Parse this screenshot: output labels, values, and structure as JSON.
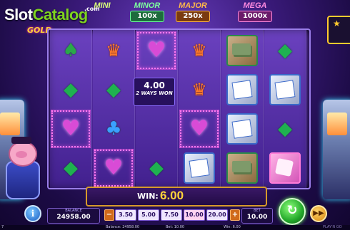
{
  "logo": {
    "brand_white": "Slot",
    "brand_green": "Catalog",
    "dotcom": ".com",
    "subtitle": "GOLD"
  },
  "jackpots": {
    "mini": {
      "name": "MINI"
    },
    "minor": {
      "name": "MINOR",
      "value": "100x"
    },
    "major": {
      "name": "MAJOR",
      "value": "250x"
    },
    "mega": {
      "name": "MEGA",
      "value": "1000x"
    }
  },
  "reels": [
    [
      "spade",
      "diamond",
      "heart",
      "diamond"
    ],
    [
      "crown",
      "diamond",
      "club",
      "heart"
    ],
    [
      "heart",
      "",
      "",
      "diamond"
    ],
    [
      "crown",
      "crown",
      "heart",
      "cards"
    ],
    [
      "cash",
      "cards",
      "cards",
      "cash"
    ],
    [
      "diamond",
      "cards",
      "diamond",
      "pink"
    ]
  ],
  "win_popup": {
    "amount": "4.00",
    "ways": "2 WAYS WON"
  },
  "win": {
    "label": "WIN:",
    "amount": "6.00"
  },
  "balance": {
    "caption": "BALANCE",
    "value": "24958.00"
  },
  "bet_options": [
    "3.50",
    "5.00",
    "7.50",
    "10.00",
    "20.00"
  ],
  "bet_selected": "10.00",
  "bet": {
    "caption": "BET",
    "value": "10.00"
  },
  "controls": {
    "minus": "−",
    "plus": "+",
    "info": "i",
    "spin": "↻",
    "auto": "▶▶"
  },
  "status": {
    "num": "7",
    "balance": "Balance: 24958.00",
    "bet": "Bet: 10.00",
    "win": "Win: 6.00",
    "provider": "PLAY'N GO"
  },
  "colors": {
    "win_amount": "#ffd43a",
    "highlight": "#ff7bf0",
    "spin": "#23a82a"
  }
}
